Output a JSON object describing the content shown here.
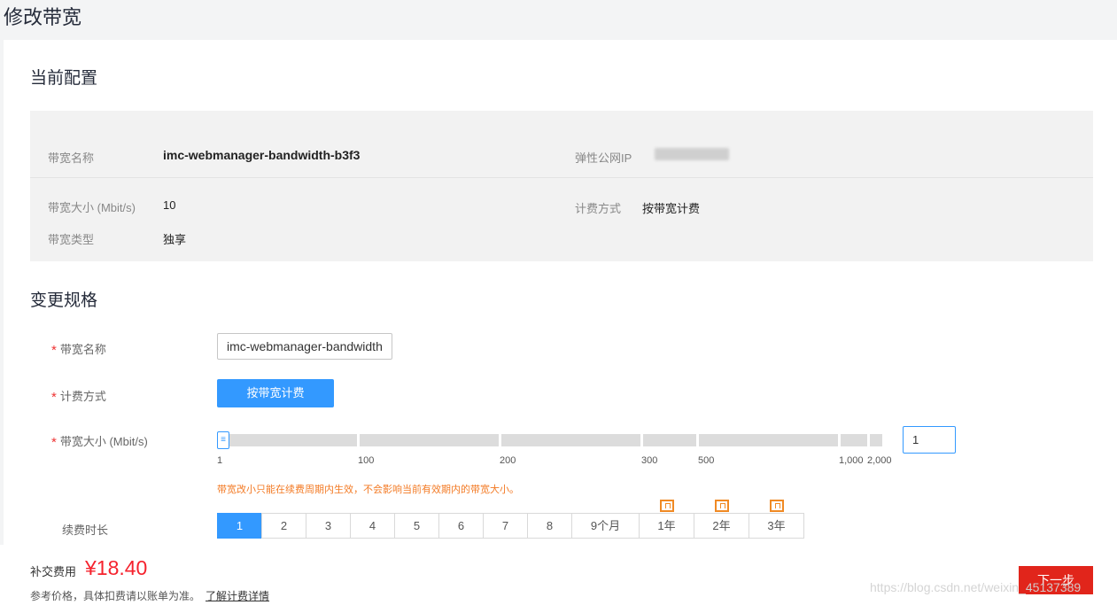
{
  "page_title": "修改带宽",
  "current": {
    "section_title": "当前配置",
    "name_label": "带宽名称",
    "name_value": "imc-webmanager-bandwidth-b3f3",
    "eip_label": "弹性公网IP",
    "size_label": "带宽大小 (Mbit/s)",
    "size_value": "10",
    "billing_label": "计费方式",
    "billing_value": "按带宽计费",
    "type_label": "带宽类型",
    "type_value": "独享"
  },
  "change": {
    "section_title": "变更规格",
    "name_label": "带宽名称",
    "name_input_value": "imc-webmanager-bandwidth",
    "billing_label": "计费方式",
    "billing_button": "按带宽计费",
    "size_label": "带宽大小 (Mbit/s)",
    "slider_value": 1,
    "slider_handle_glyph": "≡",
    "ticks": [
      "1",
      "100",
      "200",
      "300",
      "500",
      "1,000",
      "2,000"
    ],
    "size_input_value": "1",
    "size_note": "带宽改小只能在续费周期内生效，不会影响当前有效期内的带宽大小。",
    "duration_label": "续费时长",
    "durations": [
      "1",
      "2",
      "3",
      "4",
      "5",
      "6",
      "7",
      "8",
      "9个月",
      "1年",
      "2年",
      "3年"
    ],
    "selected_duration": "1"
  },
  "footer": {
    "fee_label": "补交费用",
    "fee_value": "¥18.40",
    "fee_note": "参考价格，具体扣费请以账单为准。",
    "fee_link": "了解计费详情",
    "next_button": "下一步",
    "watermark": "https://blog.csdn.net/weixin_45137389"
  },
  "colors": {
    "primary": "#3399ff",
    "danger": "#e1251b",
    "price": "#f5222d",
    "warning": "#f37a24"
  },
  "icons": {
    "year_discount": "gift-icon",
    "slider_handle": "grip-icon"
  }
}
